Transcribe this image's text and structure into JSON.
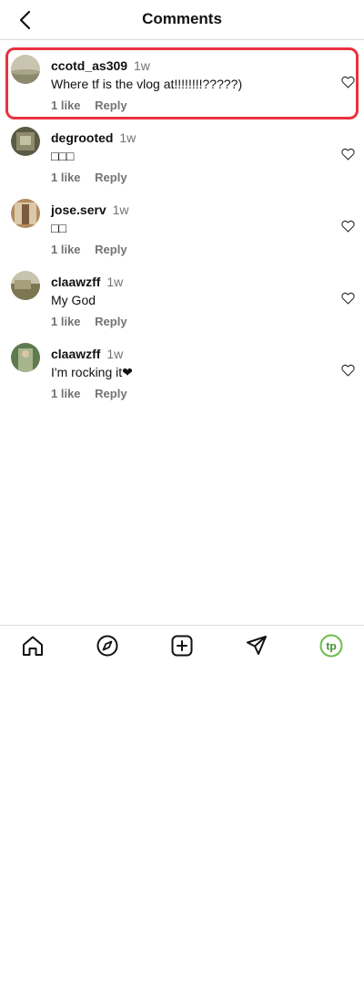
{
  "header": {
    "title": "Comments"
  },
  "comments": [
    {
      "username": "ccotd_as309",
      "time": "1w",
      "text": "Where tf is the vlog at!!!!!!!!?????)",
      "likes": "1 like",
      "reply": "Reply"
    },
    {
      "username": "degrooted",
      "time": "1w",
      "text": "□□□",
      "likes": "1 like",
      "reply": "Reply"
    },
    {
      "username": "jose.serv",
      "time": "1w",
      "text": "□□",
      "likes": "1 like",
      "reply": "Reply"
    },
    {
      "username": "claawzff",
      "time": "1w",
      "text": "My God",
      "likes": "1 like",
      "reply": "Reply"
    },
    {
      "username": "claawzff",
      "time": "1w",
      "text": "I'm rocking it❤",
      "likes": "1 like",
      "reply": "Reply"
    }
  ],
  "nav": {
    "profile_initials": "tp"
  },
  "colors": {
    "highlight": "#e8323f",
    "profile_green": "#6cc04a"
  }
}
